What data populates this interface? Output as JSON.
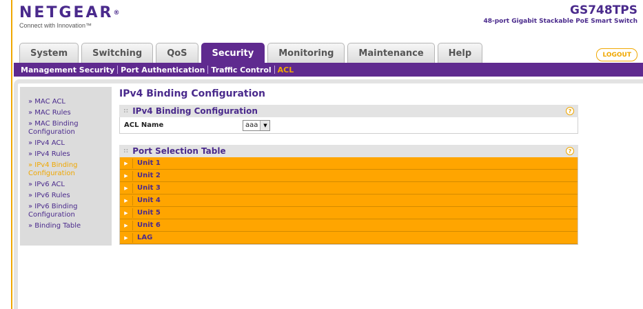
{
  "header": {
    "logo_text": "NETGEAR",
    "logo_mark": "®",
    "tagline": "Connect with Innovation™",
    "model_name": "GS748TPS",
    "model_desc": "48-port Gigabit Stackable PoE Smart Switch"
  },
  "tabs": [
    {
      "label": "System",
      "active": false
    },
    {
      "label": "Switching",
      "active": false
    },
    {
      "label": "QoS",
      "active": false
    },
    {
      "label": "Security",
      "active": true
    },
    {
      "label": "Monitoring",
      "active": false
    },
    {
      "label": "Maintenance",
      "active": false
    },
    {
      "label": "Help",
      "active": false
    }
  ],
  "logout_label": "LOGOUT",
  "subnav": [
    {
      "label": "Management Security",
      "active": false
    },
    {
      "label": "Port Authentication",
      "active": false
    },
    {
      "label": "Traffic Control",
      "active": false
    },
    {
      "label": "ACL",
      "active": true
    }
  ],
  "sidebar": [
    {
      "label": "» MAC ACL",
      "active": false
    },
    {
      "label": "» MAC Rules",
      "active": false
    },
    {
      "label": "» MAC Binding Configuration",
      "active": false
    },
    {
      "label": "» IPv4 ACL",
      "active": false
    },
    {
      "label": "» IPv4 Rules",
      "active": false
    },
    {
      "label": "» IPv4 Binding Configuration",
      "active": true
    },
    {
      "label": "» IPv6 ACL",
      "active": false
    },
    {
      "label": "» IPv6 Rules",
      "active": false
    },
    {
      "label": "» IPv6 Binding Configuration",
      "active": false
    },
    {
      "label": "» Binding Table",
      "active": false
    }
  ],
  "content": {
    "page_title": "IPv4 Binding Configuration",
    "binding_panel_title": "IPv4 Binding Configuration",
    "acl_name_label": "ACL Name",
    "acl_name_value": "aaa",
    "port_panel_title": "Port Selection Table",
    "units": [
      "Unit 1",
      "Unit 2",
      "Unit 3",
      "Unit 4",
      "Unit 5",
      "Unit 6",
      "LAG"
    ]
  },
  "icons": {
    "help": "help-icon",
    "expand": "triangle-right-icon",
    "dropdown": "triangle-down-icon"
  },
  "colors": {
    "brand_purple": "#5f2a8f",
    "accent_orange": "#ffa500",
    "text_purple": "#4a2a8c"
  }
}
